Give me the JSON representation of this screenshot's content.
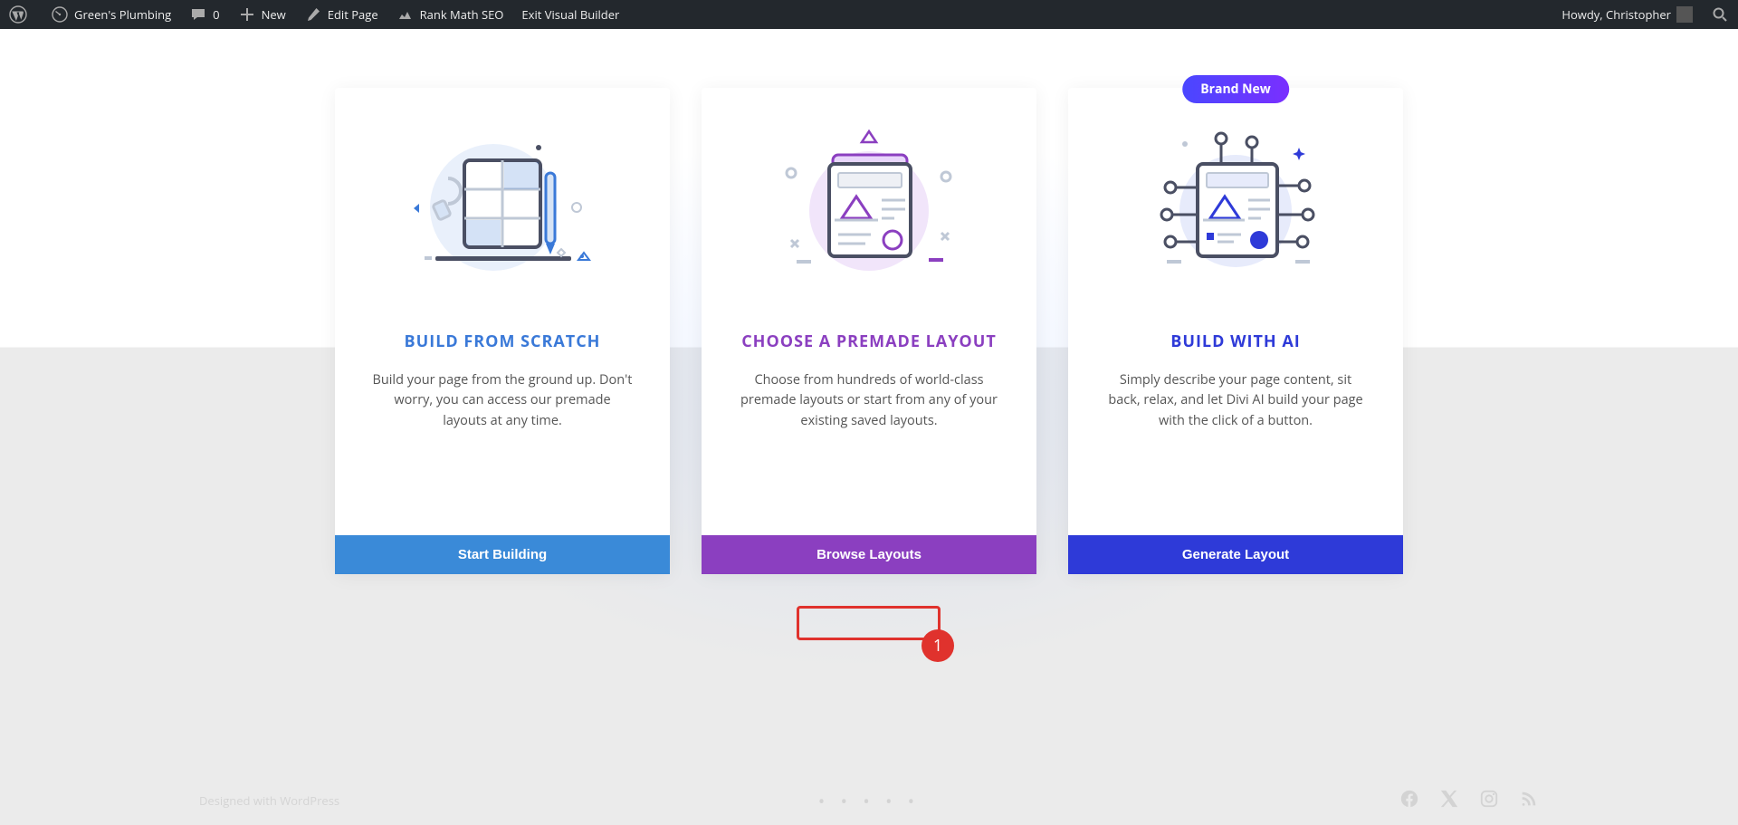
{
  "admin_bar": {
    "site_title": "Green's Plumbing",
    "comments_count": "0",
    "new_label": "New",
    "edit_page_label": "Edit Page",
    "rank_math_label": "Rank Math SEO",
    "exit_visual_builder_label": "Exit Visual Builder",
    "howdy": "Howdy, Christopher"
  },
  "cards": {
    "scratch": {
      "title": "BUILD FROM SCRATCH",
      "description": "Build your page from the ground up. Don't worry, you can access our premade layouts at any time.",
      "button": "Start Building"
    },
    "premade": {
      "title": "CHOOSE A PREMADE LAYOUT",
      "description": "Choose from hundreds of world-class premade layouts or start from any of your existing saved layouts.",
      "button": "Browse Layouts"
    },
    "ai": {
      "badge": "Brand New",
      "title": "BUILD WITH AI",
      "description": "Simply describe your page content, sit back, relax, and let Divi AI build your page with the click of a button.",
      "button": "Generate Layout"
    }
  },
  "annotation": {
    "number": "1"
  },
  "footer": {
    "left_text": "Designed with WordPress",
    "dots": "• • • • •"
  }
}
